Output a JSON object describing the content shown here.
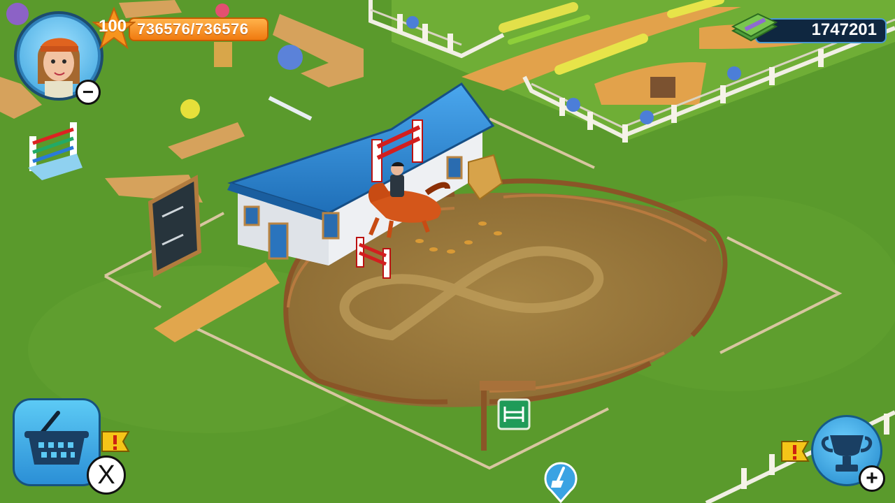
{
  "player": {
    "level": "100",
    "xp_text": "736576/736576"
  },
  "currency": {
    "money": "1747201",
    "icon": "cash-stack-icon"
  },
  "buttons": {
    "shop_icon": "basket-icon",
    "close_symbol": "X",
    "minus_symbol": "−",
    "plus_symbol": "+",
    "trophy_icon": "trophy-icon",
    "clean_icon": "broom-icon",
    "alert_icon": "exclamation-flag-icon"
  },
  "colors": {
    "grass": "#5a9a2c",
    "dirt": "#a88748",
    "path": "#e0a64c",
    "roof": "#2e86d1",
    "hud_blue": "#2b8fd6",
    "xp_orange": "#f07a10"
  }
}
